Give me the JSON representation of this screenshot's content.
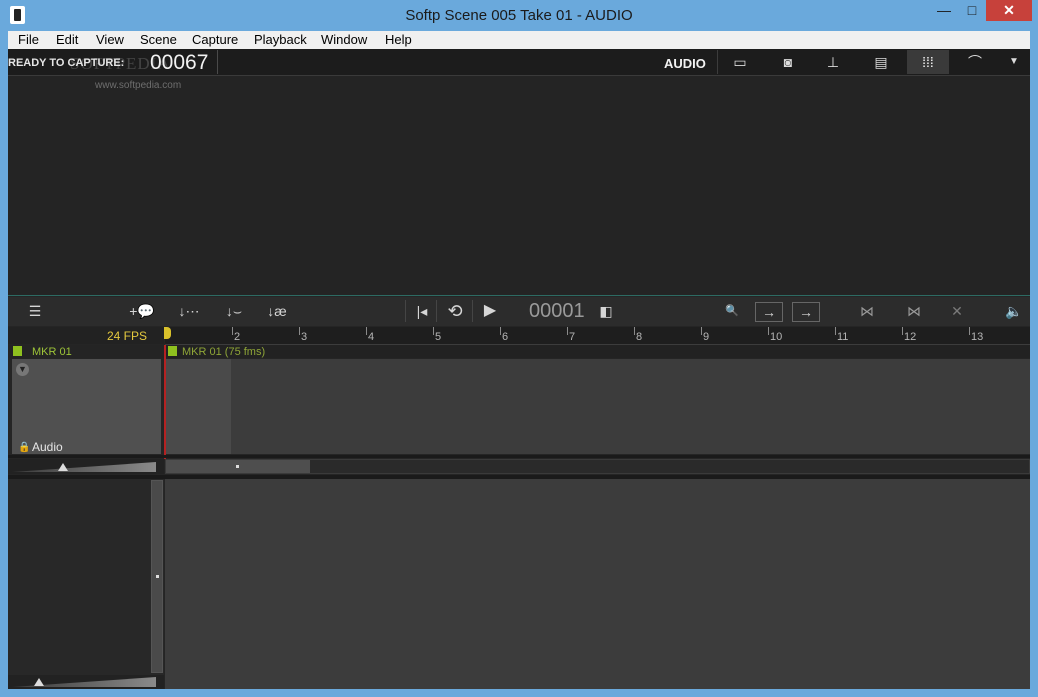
{
  "window": {
    "title": "Softp  Scene 005  Take 01 - AUDIO",
    "minimize": "—",
    "maximize": "□",
    "close": "✕"
  },
  "menu": [
    "File",
    "Edit",
    "View",
    "Scene",
    "Capture",
    "Playback",
    "Window",
    "Help"
  ],
  "capture_bar": {
    "status": "READY TO CAPTURE:",
    "frame": "00067",
    "mode_label": "AUDIO",
    "watermark": "SOFTPEDIA",
    "watermark_url": "www.softpedia.com"
  },
  "toolbar_icons": {
    "monitor": "▭",
    "camera": "◙",
    "light": "⊥",
    "xsheet": "▤",
    "waveform": "⁞⁞⁞",
    "curve": "⌒",
    "dropdown": "▼"
  },
  "timeline": {
    "frame_counter": "00001",
    "fps": "24 FPS",
    "ruler_labels": [
      "2",
      "3",
      "4",
      "5",
      "6",
      "7",
      "8",
      "9",
      "10",
      "11",
      "12",
      "13"
    ],
    "marker_left": "MKR 01",
    "marker_right": "MKR 01 (75 fms)",
    "track_name": "Audio",
    "icons": {
      "menu": "☰",
      "add_marker": "+💬",
      "insert_audio": "↓⋯",
      "insert_clip": "↓⌣",
      "insert_text": "↓æ",
      "go_start": "|◂",
      "loop": "⟲",
      "play": "▶",
      "flag": "◧",
      "zoom": "🔍",
      "arrow1": "→",
      "arrow2": "→",
      "split1": "⋈",
      "split2": "⋈",
      "delete": "✕",
      "speaker": "🔈"
    }
  }
}
